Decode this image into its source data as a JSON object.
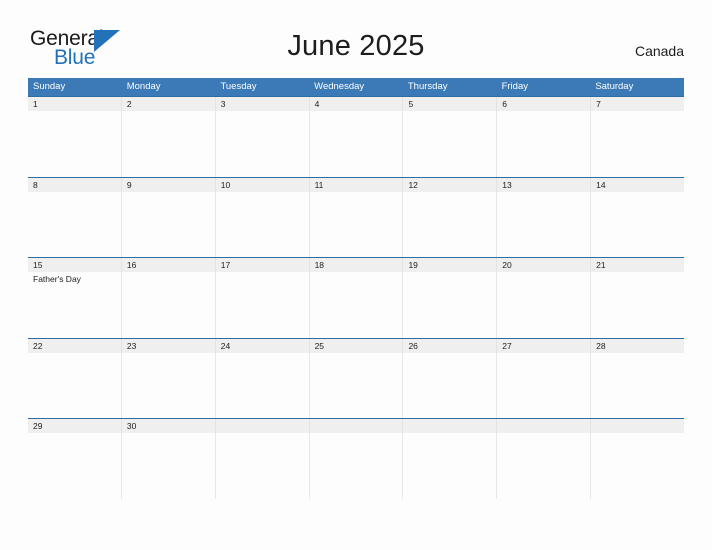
{
  "brand": {
    "word_one": "General",
    "word_two": "Blue",
    "triangle_icon": "blue-triangle-icon",
    "dark_color": "#1a1a1a",
    "blue_color": "#2272ba"
  },
  "header": {
    "title": "June 2025",
    "region": "Canada"
  },
  "theme": {
    "header_blue": "#3b7ab7",
    "row_divider_blue": "#2d6ca6",
    "number_band_gray": "#efefef",
    "page_background": "#fdfdfd",
    "text_color": "#1d1d1d"
  },
  "calendar": {
    "month": "June",
    "year": "2025",
    "weekday_headers": [
      "Sunday",
      "Monday",
      "Tuesday",
      "Wednesday",
      "Thursday",
      "Friday",
      "Saturday"
    ],
    "weeks": [
      {
        "days": [
          {
            "number": "1",
            "events": []
          },
          {
            "number": "2",
            "events": []
          },
          {
            "number": "3",
            "events": []
          },
          {
            "number": "4",
            "events": []
          },
          {
            "number": "5",
            "events": []
          },
          {
            "number": "6",
            "events": []
          },
          {
            "number": "7",
            "events": []
          }
        ]
      },
      {
        "days": [
          {
            "number": "8",
            "events": []
          },
          {
            "number": "9",
            "events": []
          },
          {
            "number": "10",
            "events": []
          },
          {
            "number": "11",
            "events": []
          },
          {
            "number": "12",
            "events": []
          },
          {
            "number": "13",
            "events": []
          },
          {
            "number": "14",
            "events": []
          }
        ]
      },
      {
        "days": [
          {
            "number": "15",
            "events": [
              "Father's Day"
            ]
          },
          {
            "number": "16",
            "events": []
          },
          {
            "number": "17",
            "events": []
          },
          {
            "number": "18",
            "events": []
          },
          {
            "number": "19",
            "events": []
          },
          {
            "number": "20",
            "events": []
          },
          {
            "number": "21",
            "events": []
          }
        ]
      },
      {
        "days": [
          {
            "number": "22",
            "events": []
          },
          {
            "number": "23",
            "events": []
          },
          {
            "number": "24",
            "events": []
          },
          {
            "number": "25",
            "events": []
          },
          {
            "number": "26",
            "events": []
          },
          {
            "number": "27",
            "events": []
          },
          {
            "number": "28",
            "events": []
          }
        ]
      },
      {
        "days": [
          {
            "number": "29",
            "events": []
          },
          {
            "number": "30",
            "events": []
          },
          {
            "number": "",
            "events": []
          },
          {
            "number": "",
            "events": []
          },
          {
            "number": "",
            "events": []
          },
          {
            "number": "",
            "events": []
          },
          {
            "number": "",
            "events": []
          }
        ]
      }
    ]
  }
}
